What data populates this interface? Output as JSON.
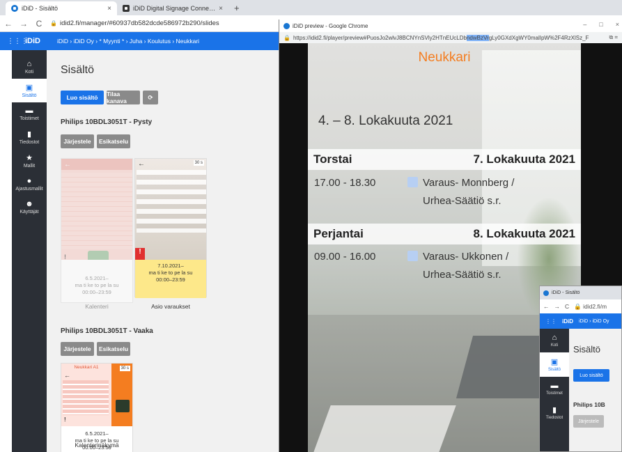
{
  "browser": {
    "tabs": [
      {
        "title": "iDiD - Sisältö",
        "close": "×"
      },
      {
        "title": "iDiD Digital Signage Connector I",
        "close": "×"
      }
    ],
    "new_tab": "+",
    "back": "←",
    "forward": "→",
    "reload": "C",
    "url": "idid2.fi/manager/#60937db582dcde586972b290/slides"
  },
  "app": {
    "logo": "iDiD",
    "breadcrumb": "iDiD › iDiD Oy › * Myynti * › Juha › Koulutus › Neukkari"
  },
  "sidebar": {
    "items": [
      {
        "icon": "home-icon",
        "glyph": "⌂",
        "label": "Koti"
      },
      {
        "icon": "image-icon",
        "glyph": "▣",
        "label": "Sisältö"
      },
      {
        "icon": "display-icon",
        "glyph": "▬",
        "label": "Toistimet"
      },
      {
        "icon": "file-icon",
        "glyph": "▮",
        "label": "Tiedostot"
      },
      {
        "icon": "star-icon",
        "glyph": "★",
        "label": "Mallit"
      },
      {
        "icon": "clock-icon",
        "glyph": "●",
        "label": "Ajastusmallit"
      },
      {
        "icon": "users-icon",
        "glyph": "☻",
        "label": "Käyttäjät"
      }
    ]
  },
  "main": {
    "title": "Sisältö",
    "create_button": "Luo sisältö",
    "order_channel_button": "Tilaa kanava",
    "refresh_glyph": "⟳",
    "section1": {
      "title": "Philips 10BDL3051T - Pysty",
      "arrange": "Järjestele",
      "preview": "Esikatselu",
      "cards": [
        {
          "foot": [
            "6.5.2021–",
            "ma ti ke to pe la su",
            "00:00–23:59"
          ],
          "name": "Kalenteri",
          "badge": "!"
        },
        {
          "foot": [
            "7.10.2021–",
            "ma ti ke to pe la su",
            "00:00–23:59"
          ],
          "name": "Asio varaukset",
          "badge": "!",
          "duration": "30 s"
        }
      ]
    },
    "section2": {
      "title": "Philips 10BDL3051T - Vaaka",
      "arrange": "Järjestele",
      "preview": "Esikatselu",
      "cards": [
        {
          "foot": [
            "6.5.2021–",
            "ma ti ke to pe la su",
            "00:00–23:59"
          ],
          "name": "Kalenterinäkymä",
          "thumb_title": "Neukkari A1",
          "duration": "30 s",
          "badge": "!"
        }
      ]
    }
  },
  "preview_window": {
    "title": "iDiD preview - Google Chrome",
    "url_pre": "https://idid2.fi/player/preview#PuosJo2wlvJ8BCNYnSVly2HTnEUcLDb",
    "url_hl": "ndwBzVr",
    "url_post": "gLy0GXdXgWY0malIpW%2F4RzXlSz_F",
    "winbtns": [
      "–",
      "□",
      "×"
    ],
    "slide": {
      "title": "Neukkari",
      "date_range": "4. – 8. Lokakuuta 2021",
      "days": [
        {
          "day": "Torstai",
          "date": "7. Lokakuuta 2021",
          "events": [
            {
              "time": "17.00 - 18.30",
              "line1": "Varaus- Monnberg /",
              "line2": "Urhea-Säätiö s.r."
            }
          ]
        },
        {
          "day": "Perjantai",
          "date": "8. Lokakuuta 2021",
          "events": [
            {
              "time": "09.00 - 16.00",
              "line1": "Varaus- Ukkonen /",
              "line2": "Urhea-Säätiö s.r."
            }
          ]
        }
      ]
    }
  },
  "small_window": {
    "tab": "iDiD - Sisältö",
    "url": "idid2.fi/m",
    "logo": "iDiD",
    "crumb": "iDiD › iDiD Oy",
    "title": "Sisältö",
    "create_button": "Luo sisältö",
    "section": "Philips 10B",
    "arrange": "Järjestele",
    "side": [
      "Koti",
      "Sisältö",
      "Toistimet",
      "Tiedostot"
    ]
  }
}
